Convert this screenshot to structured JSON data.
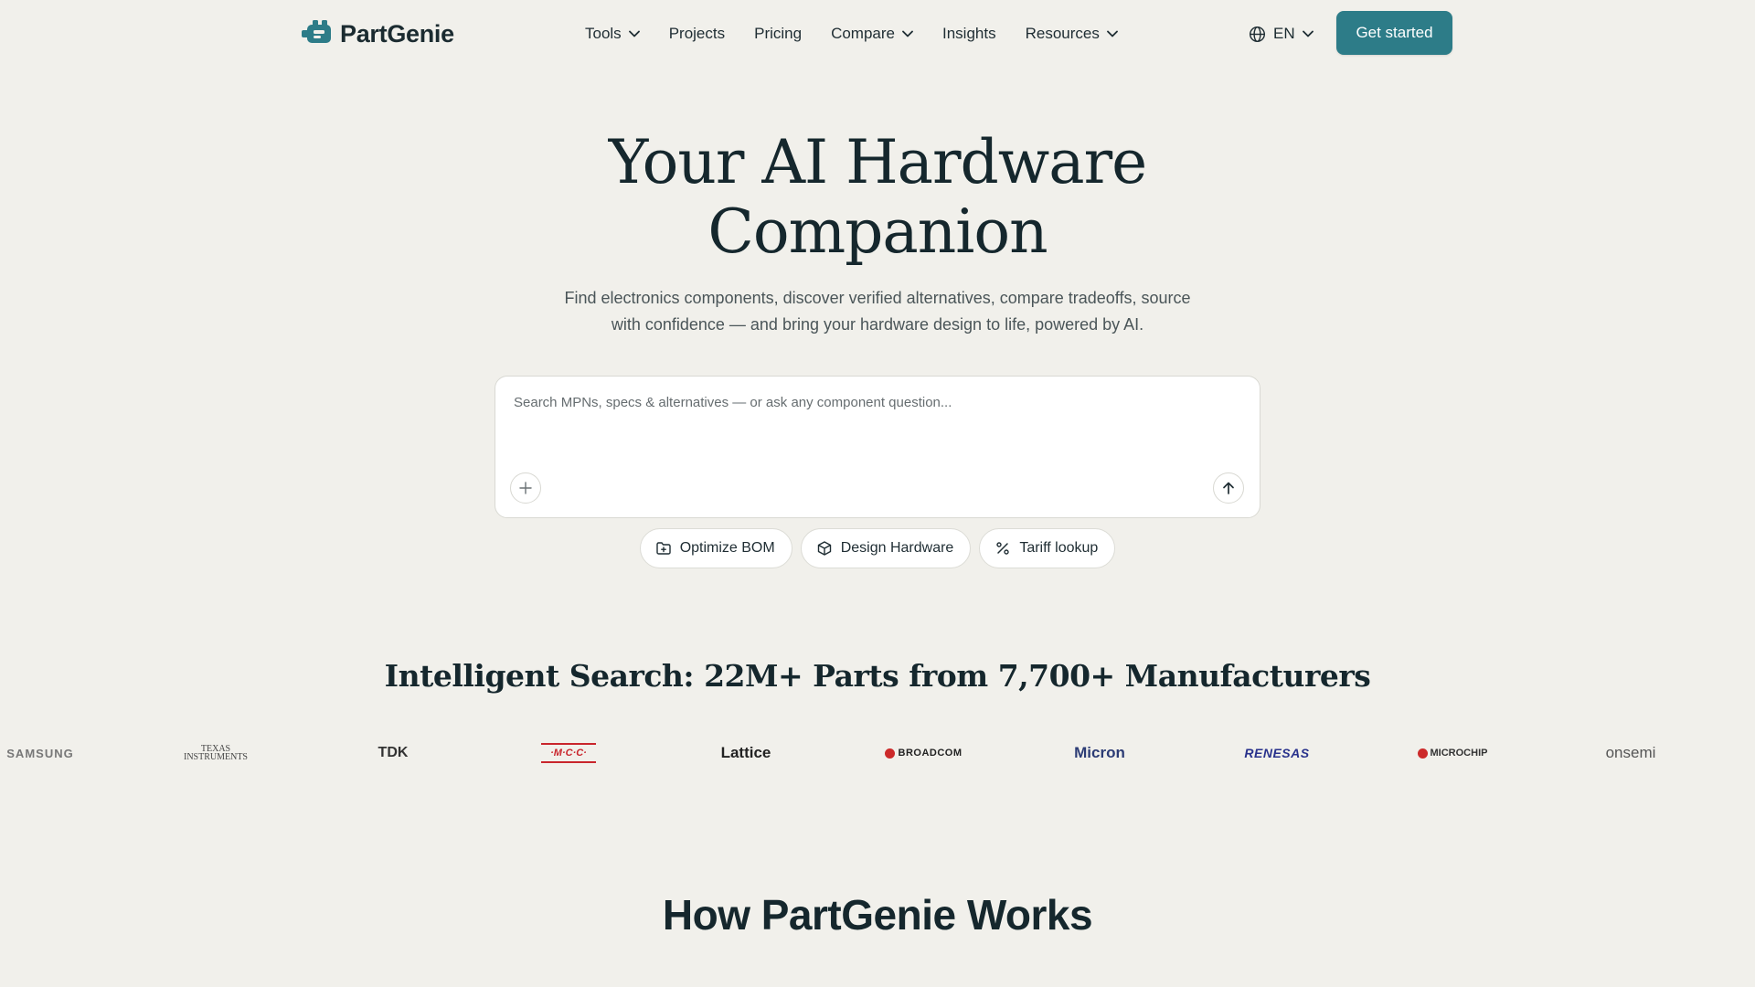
{
  "brand": {
    "name": "PartGenie",
    "accent": "#2d7c88",
    "background": "#f1f0eb"
  },
  "nav": {
    "items": [
      {
        "label": "Tools",
        "has_dropdown": true
      },
      {
        "label": "Projects",
        "has_dropdown": false
      },
      {
        "label": "Pricing",
        "has_dropdown": false
      },
      {
        "label": "Compare",
        "has_dropdown": true
      },
      {
        "label": "Insights",
        "has_dropdown": false
      },
      {
        "label": "Resources",
        "has_dropdown": true
      }
    ],
    "language": "EN",
    "cta_label": "Get started"
  },
  "hero": {
    "title_line1": "Your AI Hardware",
    "title_line2": "Companion",
    "subtitle_line1": "Find electronics components, discover verified alternatives, compare tradeoffs, source",
    "subtitle_line2": "with confidence — and bring your hardware design to life, powered by AI."
  },
  "search": {
    "placeholder": "Search MPNs, specs & alternatives — or ask any component question...",
    "value": ""
  },
  "chips": [
    {
      "label": "Optimize BOM",
      "icon": "folder-plus-icon"
    },
    {
      "label": "Design Hardware",
      "icon": "cube-icon"
    },
    {
      "label": "Tariff lookup",
      "icon": "percent-icon"
    }
  ],
  "manufacturers": {
    "title": "Intelligent Search: 22M+ Parts from 7,700+ Manufacturers",
    "logos": [
      {
        "name": "Samsung",
        "text": "SAMSUNG"
      },
      {
        "name": "Texas Instruments",
        "text": "TEXAS",
        "text2": "INSTRUMENTS"
      },
      {
        "name": "TDK",
        "text": "TDK"
      },
      {
        "name": "MCC",
        "text": "·M·C·C·"
      },
      {
        "name": "Lattice",
        "text": "Lattice"
      },
      {
        "name": "Broadcom",
        "text": "BROADCOM"
      },
      {
        "name": "Micron",
        "text": "Micron"
      },
      {
        "name": "Renesas",
        "text": "RENESAS"
      },
      {
        "name": "Microchip",
        "text": "MICROCHIP"
      },
      {
        "name": "onsemi",
        "text": "onsemi"
      }
    ]
  },
  "how": {
    "title": "How PartGenie Works"
  }
}
